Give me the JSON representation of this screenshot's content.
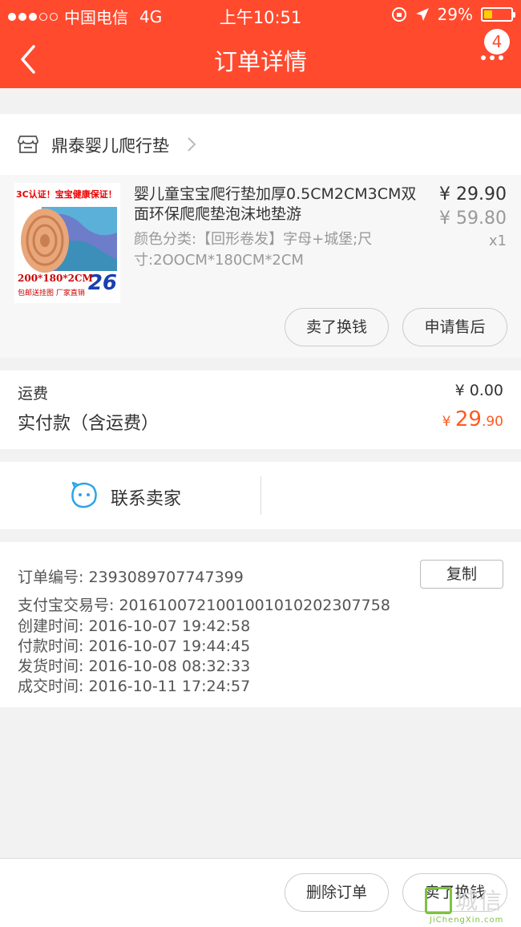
{
  "status_bar": {
    "carrier": "中国电信",
    "network": "4G",
    "time": "上午10:51",
    "battery": "29%",
    "battery_level": 0.29
  },
  "nav": {
    "title": "订单详情",
    "badge": "4"
  },
  "shop": {
    "name": "鼎泰婴儿爬行垫"
  },
  "product": {
    "title": "婴儿童宝宝爬行垫加厚0.5CM2CM3CM双面环保爬爬垫泡沫地垫游",
    "sku": "颜色分类:【回形卷发】字母+城堡;尺寸:2OOCM*180CM*2CM",
    "price": "¥ 29.90",
    "original_price": "¥ 59.80",
    "quantity": "x1",
    "image_text": {
      "top": "3C认证！宝宝健康保证！",
      "dims": "200*180*2CM",
      "sub": "包邮送挂图 厂家直销",
      "price": "26"
    },
    "sell_label": "卖了换钱",
    "aftersale_label": "申请售后"
  },
  "fee": {
    "shipping_label": "运费",
    "shipping_value": "¥ 0.00",
    "paid_label": "实付款（含运费）",
    "paid_symbol": "¥",
    "paid_int": "29",
    "paid_dec": ".90"
  },
  "contact": {
    "label": "联系卖家"
  },
  "order_info": {
    "copy_label": "复制",
    "rows": [
      "订单编号:   2393089707747399",
      "支付宝交易号:   2016100721001001010202307758",
      "创建时间:   2016-10-07 19:42:58",
      "付款时间:   2016-10-07 19:44:45",
      "发货时间:   2016-10-08 08:32:33",
      "成交时间:   2016-10-11 17:24:57"
    ]
  },
  "bottom": {
    "delete_label": "删除订单",
    "sell_label": "卖了换钱"
  },
  "watermark": {
    "text": "城信",
    "url": "JiChengXin.com"
  },
  "colors": {
    "brand": "#ff4a2e",
    "price_accent": "#ff5a1f",
    "battery": "#ffd000"
  }
}
